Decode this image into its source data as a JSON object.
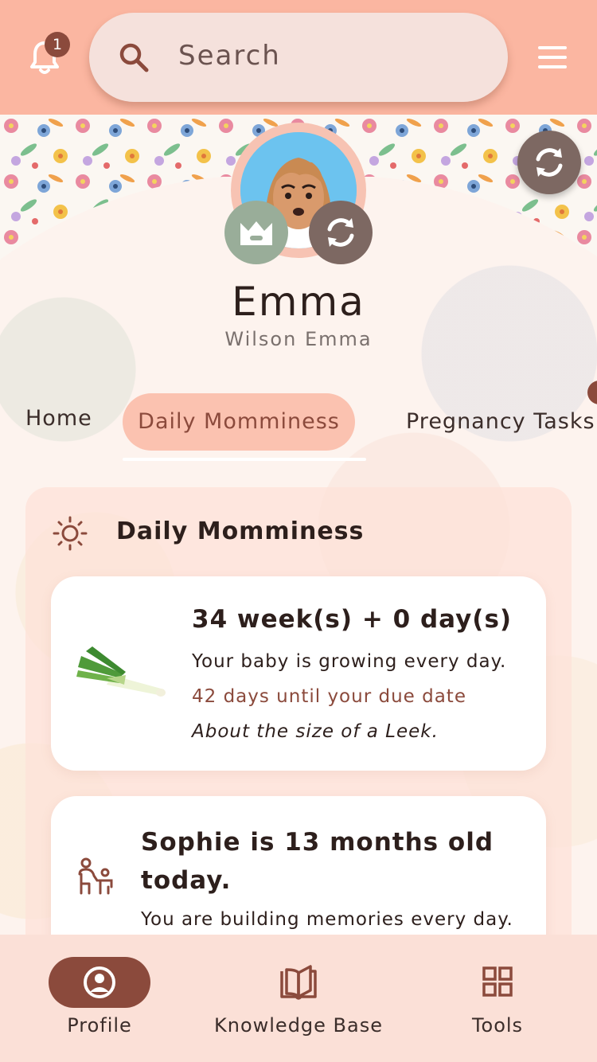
{
  "header": {
    "notification_count": "1",
    "search_placeholder": "Search",
    "icons": [
      "bell-icon",
      "search-icon",
      "menu-icon"
    ]
  },
  "profile": {
    "name": "Emma",
    "subname": "Wilson Emma"
  },
  "tabs": [
    {
      "label": "Home",
      "active": false
    },
    {
      "label": "Daily Momminess",
      "active": true
    },
    {
      "label": "Pregnancy Tasks",
      "active": false
    }
  ],
  "section": {
    "title": "Daily Momminess",
    "pregnancy_card": {
      "title": "34 week(s) + 0 day(s)",
      "line1": "Your baby is growing every day.",
      "line2": "42 days until your due date",
      "line3": "About the size of a Leek."
    },
    "child_card": {
      "title": "Sophie is 13 months old today.",
      "line1": "You are building memories every day."
    }
  },
  "bottom_nav": [
    {
      "label": "Profile",
      "icon": "profile-icon",
      "active": true
    },
    {
      "label": "Knowledge Base",
      "icon": "book-icon",
      "active": false
    },
    {
      "label": "Tools",
      "icon": "grid-icon",
      "active": false
    }
  ],
  "colors": {
    "header": "#fbb6a1",
    "accent": "#8b4a3c",
    "active_tab": "#fbc2b0",
    "nav_bg": "#fbe0d7"
  }
}
